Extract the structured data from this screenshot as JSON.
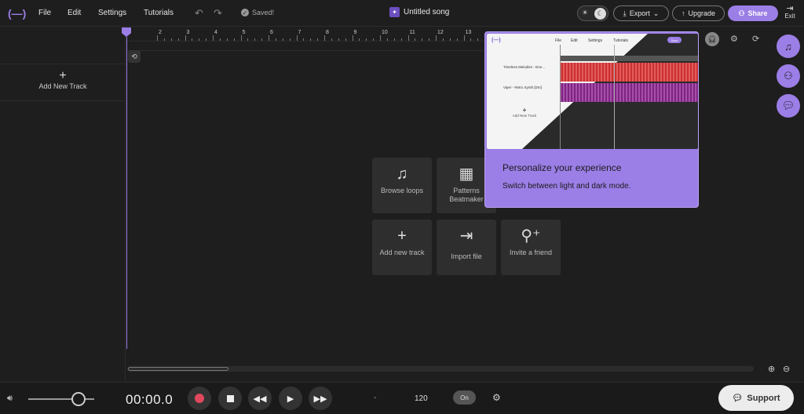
{
  "menu": {
    "file": "File",
    "edit": "Edit",
    "settings": "Settings",
    "tutorials": "Tutorials"
  },
  "status": {
    "saved": "Saved!"
  },
  "project": {
    "title": "Untitled song"
  },
  "header": {
    "export": "Export",
    "upgrade": "Upgrade",
    "share": "Share",
    "exit": "Exit"
  },
  "tracks": {
    "add_new_track": "Add New Track"
  },
  "ruler": {
    "labels": [
      "2",
      "3",
      "4",
      "5",
      "6",
      "7",
      "8",
      "9",
      "10",
      "11",
      "12",
      "13"
    ]
  },
  "tiles": {
    "browse_loops": "Browse loops",
    "patterns": "Patterns Beatmaker",
    "add_new_track": "Add new track",
    "import_file": "Import file",
    "invite_friend": "Invite a friend"
  },
  "popover": {
    "title": "Personalize your experience",
    "subtitle": "Switch between light and dark mode.",
    "preview": {
      "menu": [
        "File",
        "Edit",
        "Settings",
        "Tutorials"
      ],
      "save": "Save",
      "track1": "Timeless Melodies - Ene...",
      "track2": "Viper - Retro Synth [Dm]",
      "add_track": "Add New Track"
    }
  },
  "transport": {
    "time": "00:00.0",
    "dash": "-",
    "bpm": "120",
    "metronome": "On"
  },
  "support": {
    "label": "Support"
  },
  "colors": {
    "accent": "#9b7ee6",
    "background": "#1e1e1e",
    "record": "#e0485d"
  }
}
